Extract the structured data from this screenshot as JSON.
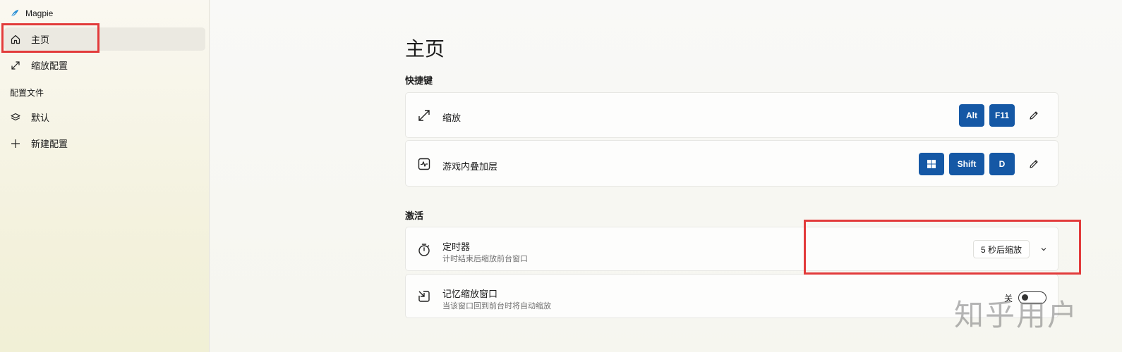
{
  "app": {
    "title": "Magpie"
  },
  "sidebar": {
    "items": [
      {
        "label": "主页",
        "icon": "home-icon",
        "active": true
      },
      {
        "label": "缩放配置",
        "icon": "resize-icon"
      }
    ],
    "section_label": "配置文件",
    "profiles": [
      {
        "label": "默认",
        "icon": "layers-icon"
      },
      {
        "label": "新建配置",
        "icon": "plus-icon"
      }
    ]
  },
  "main": {
    "title": "主页",
    "shortcuts": {
      "heading": "快捷键",
      "items": [
        {
          "label": "缩放",
          "icon": "resize-icon",
          "keys": [
            "Alt",
            "F11"
          ]
        },
        {
          "label": "游戏内叠加层",
          "icon": "activity-icon",
          "keys": [
            "win-logo",
            "Shift",
            "D"
          ]
        }
      ]
    },
    "activation": {
      "heading": "激活",
      "timer": {
        "title": "定时器",
        "subtitle": "计时结束后缩放前台窗口",
        "value": "5 秒后缩放"
      },
      "remember": {
        "title": "记忆缩放窗口",
        "subtitle": "当该窗口回到前台时将自动缩放",
        "toggle_label": "关",
        "toggle_on": false
      }
    }
  },
  "watermark": "知乎用户",
  "colors": {
    "accent": "#1558a5",
    "highlight": "#e23b3b"
  }
}
